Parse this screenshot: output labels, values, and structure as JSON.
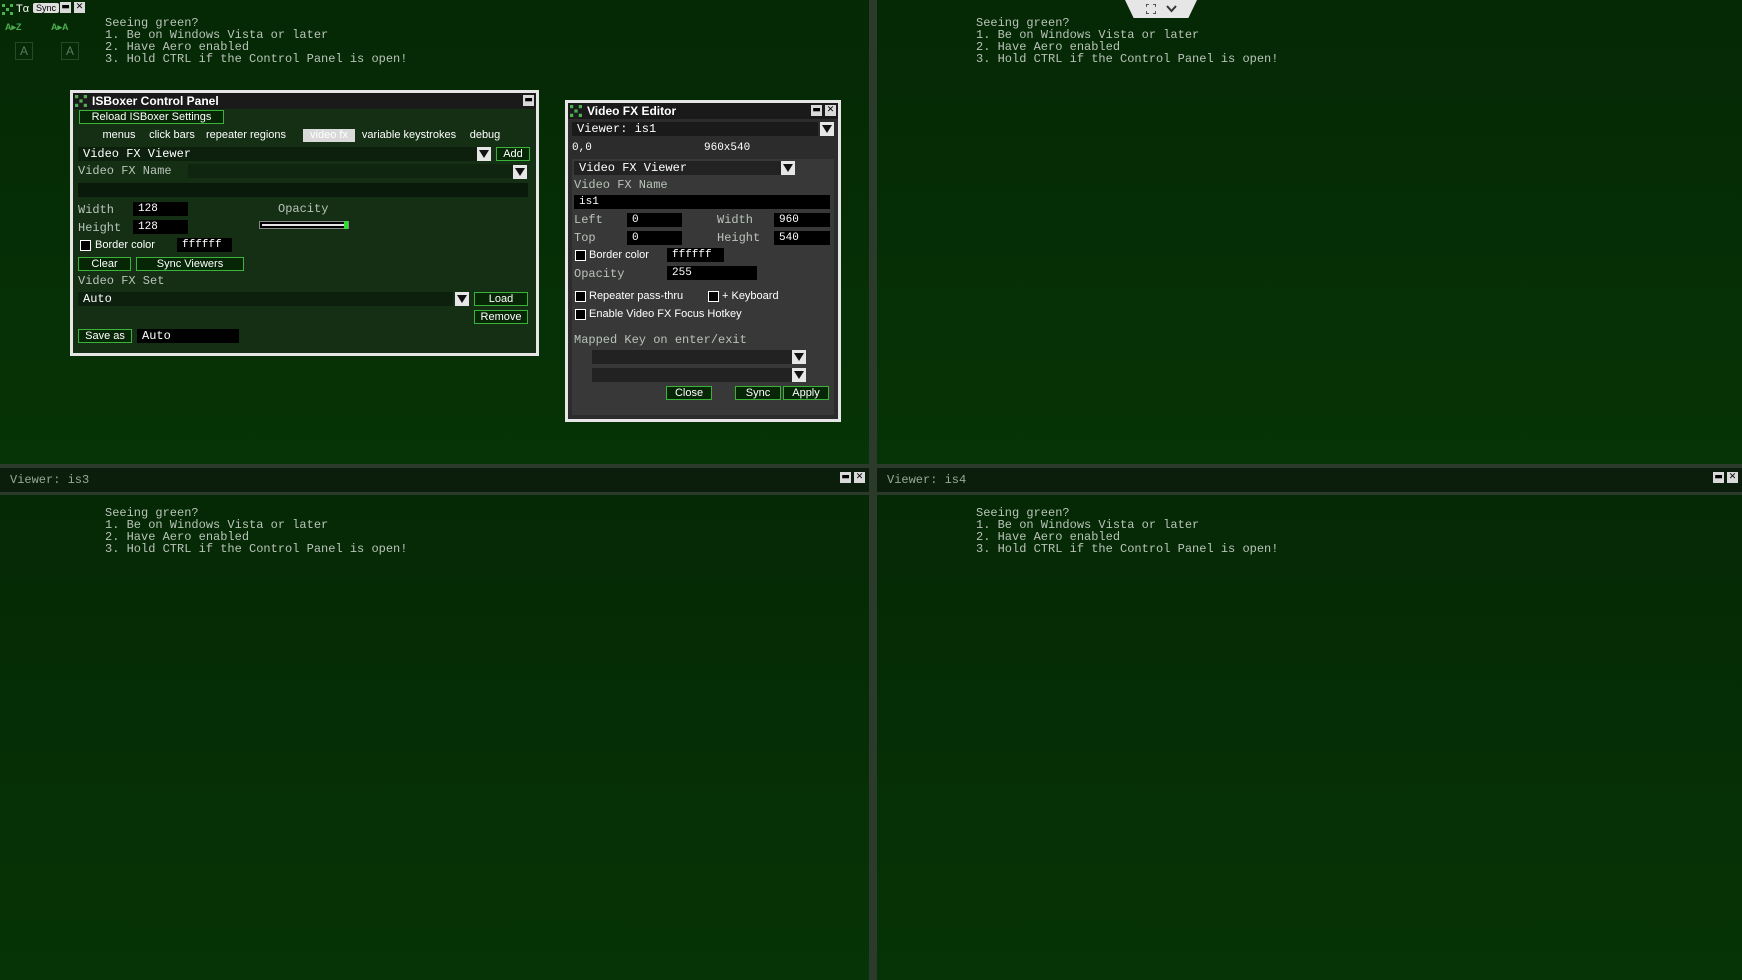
{
  "colors": {
    "bg": "#052805",
    "accent": "#3bb33b",
    "window_border": "#e6e6e6",
    "panel_dark": "#142f14"
  },
  "hint": {
    "line1": "Seeing green?",
    "line2": "1. Be on Windows Vista or later",
    "line3": "2. Have Aero enabled",
    "line4": "3. Hold CTRL if the Control Panel is open!"
  },
  "toolbar": {
    "title": "Tα",
    "sync_label": "Sync",
    "key_a1": "A",
    "key_a2": "A",
    "group1": "A▸Z",
    "group2": "A▸A"
  },
  "viewers": {
    "is3": "Viewer: is3",
    "is4": "Viewer: is4"
  },
  "icons": {
    "fullscreen": "expand-icon",
    "dropdown": "chevron-down-icon",
    "logo": "isboxer-logo-icon"
  },
  "control_panel": {
    "title": "ISBoxer Control Panel",
    "reload_button": "Reload ISBoxer Settings",
    "tabs": [
      "menus",
      "click bars",
      "repeater regions",
      "video fx",
      "variable keystrokes",
      "debug"
    ],
    "active_tab": "video fx",
    "viewer_type": "Video FX Viewer",
    "add_button": "Add",
    "name_label": "Video FX Name",
    "name_value": "",
    "width_label": "Width",
    "width_value": "128",
    "height_label": "Height",
    "height_value": "128",
    "opacity_label": "Opacity",
    "opacity_fraction": 1.0,
    "border_color_label": "Border color",
    "border_color_value": "ffffff",
    "clear_button": "Clear",
    "sync_viewers_button": "Sync Viewers",
    "set_label": "Video FX Set",
    "set_value": "Auto",
    "load_button": "Load",
    "remove_button": "Remove",
    "save_as_button": "Save as",
    "save_as_value": "Auto"
  },
  "fx_editor": {
    "title": "Video FX Editor",
    "viewer_select": "Viewer: is1",
    "pos_text": "0,0",
    "size_text": "960x540",
    "type_value": "Video FX Viewer",
    "name_label": "Video FX Name",
    "name_value": "is1",
    "left_label": "Left",
    "left_value": "0",
    "width_label": "Width",
    "width_value": "960",
    "top_label": "Top",
    "top_value": "0",
    "height_label": "Height",
    "height_value": "540",
    "border_color_label": "Border color",
    "border_color_value": "ffffff",
    "opacity_label": "Opacity",
    "opacity_value": "255",
    "repeater_label": "Repeater pass-thru",
    "keyboard_label": "+ Keyboard",
    "focus_hotkey_label": "Enable Video FX Focus Hotkey",
    "mapped_key_label": "Mapped Key on enter/exit",
    "mapped_key_1": "",
    "mapped_key_2": "",
    "close_button": "Close",
    "sync_button": "Sync",
    "apply_button": "Apply"
  }
}
